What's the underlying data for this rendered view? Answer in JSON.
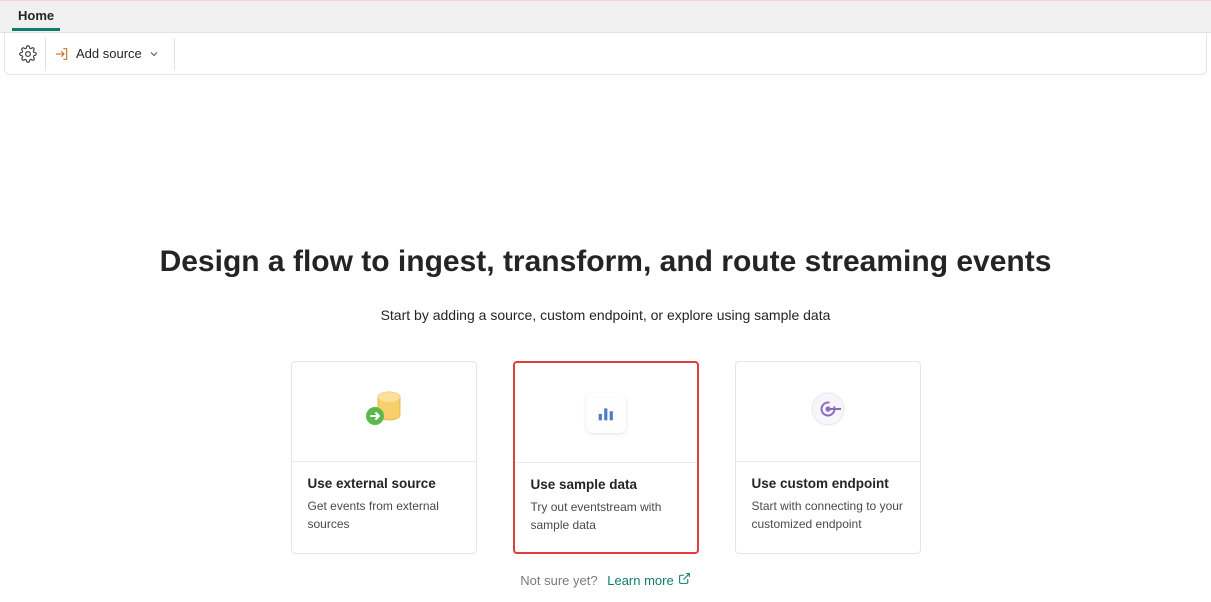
{
  "tabs": {
    "home_label": "Home"
  },
  "toolbar": {
    "add_source_label": "Add source"
  },
  "main": {
    "headline": "Design a flow to ingest, transform, and route streaming events",
    "subhead": "Start by adding a source, custom endpoint, or explore using sample data",
    "cards": [
      {
        "title": "Use external source",
        "desc": "Get events from external sources",
        "icon": "database-arrow-icon"
      },
      {
        "title": "Use sample data",
        "desc": "Try out eventstream with sample data",
        "icon": "bar-chart-icon"
      },
      {
        "title": "Use custom endpoint",
        "desc": "Start with connecting to your customized endpoint",
        "icon": "endpoint-icon"
      }
    ],
    "hint_text": "Not sure yet?",
    "learn_more": "Learn more"
  }
}
